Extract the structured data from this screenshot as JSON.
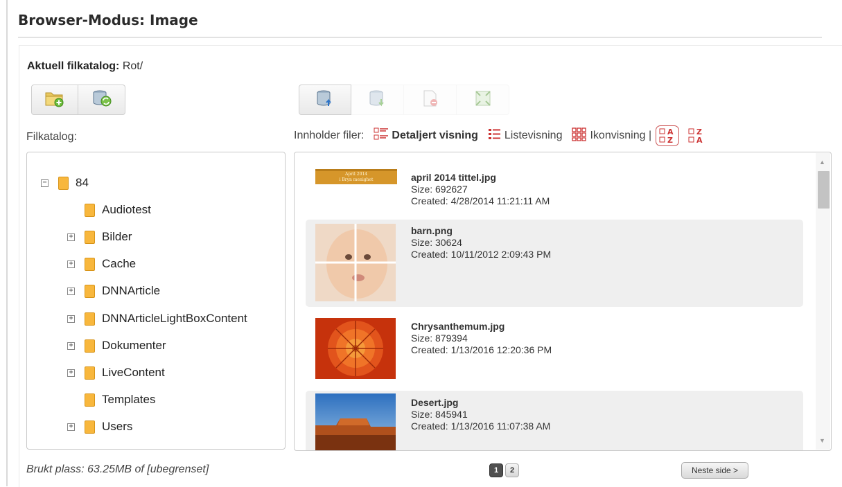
{
  "page_title": "Browser-Modus: Image",
  "current_directory": {
    "label": "Aktuell filkatalog:",
    "value": "Rot/"
  },
  "folder_label": "Filkatalog:",
  "folder_tree": [
    {
      "label": "84",
      "expander": "−"
    },
    {
      "label": "Audiotest",
      "expander": ""
    },
    {
      "label": "Bilder",
      "expander": "+"
    },
    {
      "label": "Cache",
      "expander": "+"
    },
    {
      "label": "DNNArticle",
      "expander": "+"
    },
    {
      "label": "DNNArticleLightBoxContent",
      "expander": "+"
    },
    {
      "label": "Dokumenter",
      "expander": "+"
    },
    {
      "label": "LiveContent",
      "expander": "+"
    },
    {
      "label": "Templates",
      "expander": ""
    },
    {
      "label": "Users",
      "expander": "+"
    }
  ],
  "view_bar": {
    "label": "Innholder filer:",
    "detailed": "Detaljert visning",
    "list": "Listevisning",
    "icons": "Ikonvisning |",
    "sort_asc_top": "A",
    "sort_asc_bottom": "Z",
    "sort_desc_top": "Z",
    "sort_desc_bottom": "A"
  },
  "files": [
    {
      "name": "april 2014 tittel.jpg",
      "size": "Size: 692627",
      "created": "Created: 4/28/2014 11:21:11 AM",
      "thumb_text_1": "April 2014",
      "thumb_text_2": "i Bryn menighet"
    },
    {
      "name": "barn.png",
      "size": "Size: 30624",
      "created": "Created: 10/11/2012 2:09:43 PM"
    },
    {
      "name": "Chrysanthemum.jpg",
      "size": "Size: 879394",
      "created": "Created: 1/13/2016 12:20:36 PM"
    },
    {
      "name": "Desert.jpg",
      "size": "Size: 845941",
      "created": "Created: 1/13/2016 11:07:38 AM"
    }
  ],
  "footer": {
    "used_space": "Brukt plass: 63.25MB of [ubegrenset]",
    "pages": [
      "1",
      "2"
    ],
    "next_button": "Neste side >"
  },
  "colors": {
    "folder": "#f8b73d",
    "sort_active_border": "#cc5555",
    "current_page": "#4f4f4f"
  },
  "icons": {
    "new_folder": "folder-add-icon",
    "sync": "database-sync-icon",
    "upload": "database-upload-icon",
    "download": "database-download-icon",
    "delete": "file-delete-icon",
    "resize": "image-resize-icon"
  }
}
